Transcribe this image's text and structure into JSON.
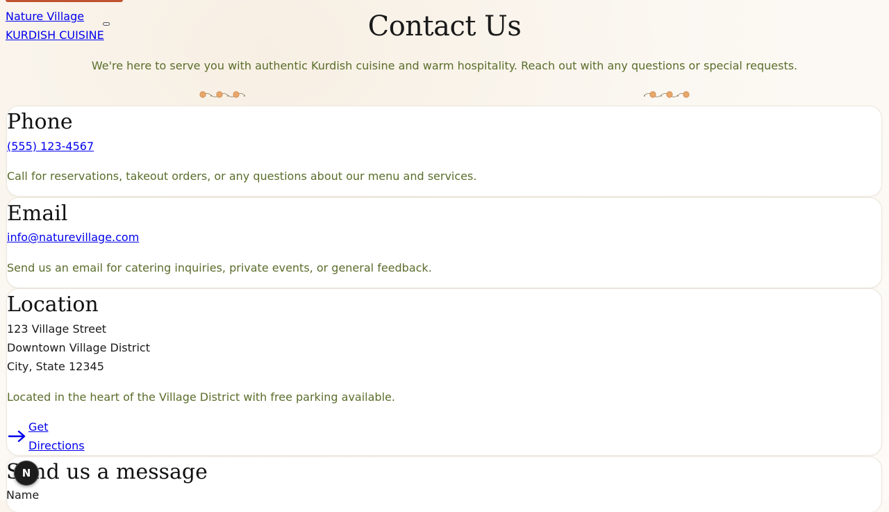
{
  "brand": {
    "name_line1": "Nature Village",
    "name_line2": "KURDISH CUISINE"
  },
  "page": {
    "title": "Contact Us",
    "intro": "We're here to serve you with authentic Kurdish cuisine and warm hospitality. Reach out with any questions or special requests."
  },
  "phone": {
    "heading": "Phone",
    "number": "(555) 123-4567",
    "description": "Call for reservations, takeout orders, or any questions about our menu and services."
  },
  "email": {
    "heading": "Email",
    "address": "info@naturevillage.com",
    "description": "Send us an email for catering inquiries, private events, or general feedback."
  },
  "location": {
    "heading": "Location",
    "address_line1": "123 Village Street",
    "address_line2": "Downtown Village District",
    "address_line3": "City, State 12345",
    "description": "Located in the heart of the Village District with free parking available.",
    "directions_line1": "Get",
    "directions_line2": "Directions"
  },
  "form": {
    "heading": "Send us a message",
    "name_label": "Name"
  },
  "badge": {
    "letter": "N"
  },
  "colors": {
    "accent": "#c0532f",
    "muted_green": "#5a6d2b",
    "link": "#0000ee",
    "ornament": "#e9a76a"
  },
  "icons": {
    "directions": "arrow-right-icon",
    "ornament": "dot-vine-ornament"
  }
}
